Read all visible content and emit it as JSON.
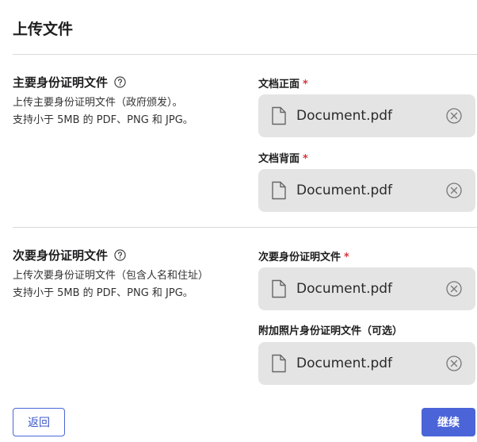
{
  "page_title": "上传文件",
  "primary": {
    "heading": "主要身份证明文件",
    "desc_line1": "上传主要身份证明文件（政府颁发）。",
    "desc_line2": "支持小于 5MB 的 PDF、PNG 和 JPG。",
    "front_label": "文档正面",
    "front_file": "Document.pdf",
    "back_label": "文档背面",
    "back_file": "Document.pdf"
  },
  "secondary": {
    "heading": "次要身份证明文件",
    "desc_line1": "上传次要身份证明文件（包含人名和住址）",
    "desc_line2": "支持小于 5MB 的 PDF、PNG 和 JPG。",
    "doc_label": "次要身份证明文件",
    "doc_file": "Document.pdf",
    "extra_label": "附加照片身份证明文件（可选）",
    "extra_file": "Document.pdf"
  },
  "required_mark": "*",
  "buttons": {
    "back": "返回",
    "continue": "继续"
  },
  "colors": {
    "accent": "#4b64d8",
    "required": "#d9363e",
    "file_box_bg": "#e4e4e4"
  },
  "icons": {
    "help": "question-circle-icon",
    "file": "document-icon",
    "remove": "close-circle-icon"
  }
}
